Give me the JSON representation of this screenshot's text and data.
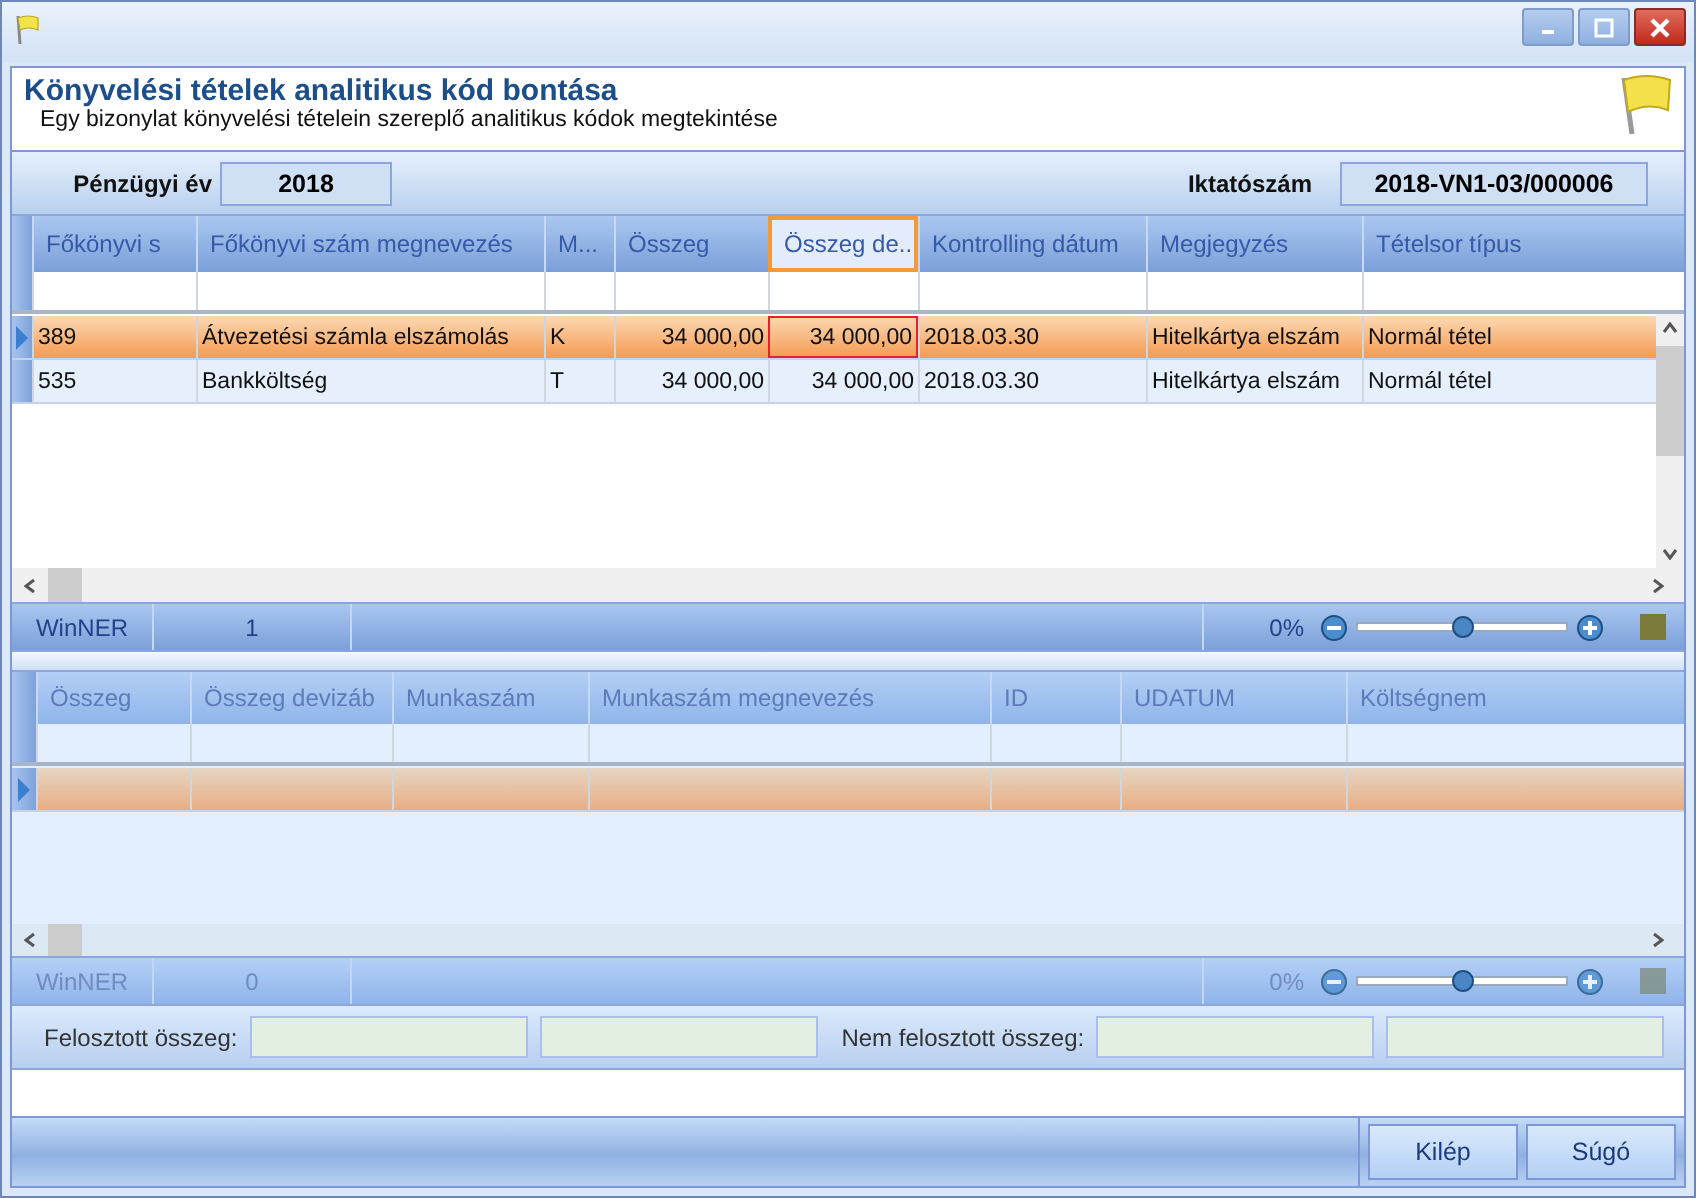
{
  "header": {
    "title": "Könyvelési tételek analitikus kód bontása",
    "subtitle": "Egy bizonylat könyvelési tételein szereplő analitikus kódok megtekintése"
  },
  "info": {
    "year_label": "Pénzügyi év",
    "year": "2018",
    "reg_label": "Iktatószám",
    "reg": "2018-VN1-03/000006"
  },
  "grid1": {
    "columns": [
      {
        "label": "Főkönyvi s",
        "selected": false
      },
      {
        "label": "Főkönyvi szám megnevezés",
        "selected": false
      },
      {
        "label": "M...",
        "selected": false
      },
      {
        "label": "Összeg",
        "selected": false
      },
      {
        "label": "Összeg de...",
        "selected": true
      },
      {
        "label": "Kontrolling dátum",
        "selected": false
      },
      {
        "label": "Megjegyzés",
        "selected": false
      },
      {
        "label": "Tételsor típus",
        "selected": false
      }
    ],
    "rows": [
      {
        "selected": true,
        "cells": [
          "389",
          "Átvezetési számla  elszámolás",
          "K",
          "34 000,00",
          "34 000,00",
          "2018.03.30",
          "Hitelkártya elszám",
          "Normál tétel"
        ]
      },
      {
        "selected": false,
        "cells": [
          "535",
          "Bankköltség",
          "T",
          "34 000,00",
          "34 000,00",
          "2018.03.30",
          "Hitelkártya elszám",
          "Normál tétel"
        ]
      }
    ],
    "footer": {
      "label": "WinNER",
      "count": "1",
      "percent": "0%",
      "level": 0.5,
      "disabled": false
    }
  },
  "grid2": {
    "columns": [
      {
        "label": "Összeg",
        "selected": false
      },
      {
        "label": "Összeg devizáb",
        "selected": false
      },
      {
        "label": "Munkaszám",
        "selected": false
      },
      {
        "label": "Munkaszám megnevezés",
        "selected": false
      },
      {
        "label": "ID",
        "selected": false
      },
      {
        "label": "UDATUM",
        "selected": false
      },
      {
        "label": "Költségnem",
        "selected": false
      }
    ],
    "rows": [
      {
        "selected": true
      }
    ],
    "footer": {
      "label": "WinNER",
      "count": "0",
      "percent": "0%",
      "level": 0.5,
      "disabled": true
    }
  },
  "totals": {
    "allocated_label": "Felosztott összeg:",
    "unallocated_label": "Nem felosztott összeg:"
  },
  "buttons": [
    "Kilép",
    "Súgó"
  ]
}
